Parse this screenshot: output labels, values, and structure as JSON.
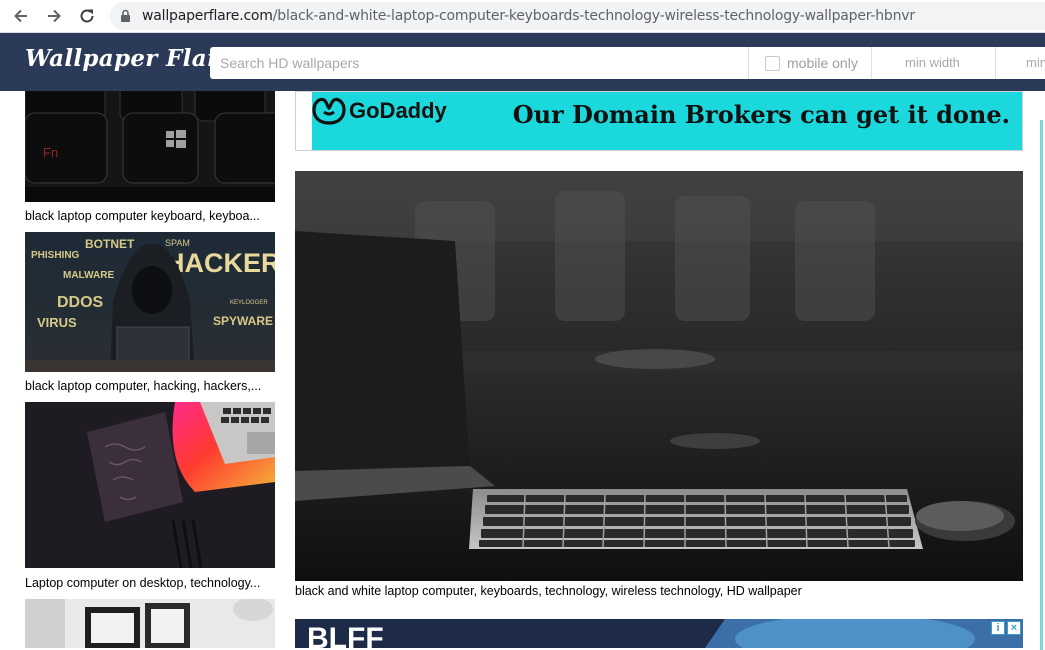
{
  "browser": {
    "url_domain": "wallpaperflare.com",
    "url_path": "/black-and-white-laptop-computer-keyboards-technology-wireless-technology-wallpaper-hbnvr"
  },
  "header": {
    "logo": "Wallpaper Flare",
    "search_placeholder": "Search HD wallpapers",
    "mobile_only_label": "mobile only",
    "min_width_label": "min width",
    "min_height_label": "min"
  },
  "sidebar": {
    "items": [
      {
        "caption": "black laptop computer keyboard, keyboa..."
      },
      {
        "caption": "black laptop computer, hacking, hackers,..."
      },
      {
        "caption": "Laptop computer on desktop, technology..."
      },
      {
        "caption": ""
      }
    ],
    "hacker_words": [
      "BOTNET",
      "SPAM",
      "PHISHING",
      "MALWARE",
      "HACKER",
      "DDOS",
      "VIRUS",
      "SPYWARE",
      "KEYLOGGER"
    ]
  },
  "ad": {
    "brand": "GoDaddy",
    "tagline": "Our Domain Brokers can get it done."
  },
  "main": {
    "caption": "black and white laptop computer, keyboards, technology, wireless technology, HD wallpaper"
  },
  "bottom_ad": {
    "text": "BLFF"
  },
  "colors": {
    "header_bg": "#2b3a58",
    "ad_bg": "#1bd8dc"
  }
}
